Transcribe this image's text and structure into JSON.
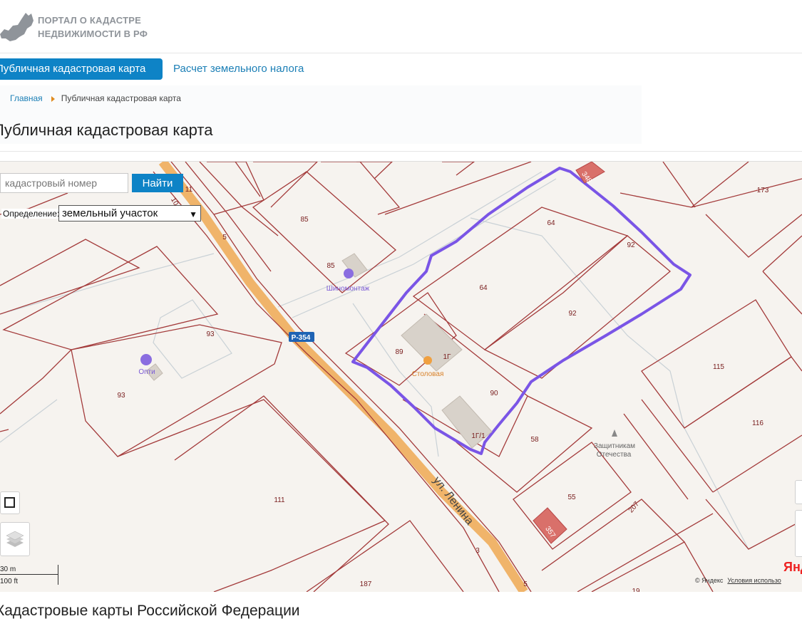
{
  "header": {
    "logo_line1": "ПОРТАЛ О КАДАСТРЕ",
    "logo_line2": "НЕДВИЖИМОСТИ В РФ",
    "logo_icon": "russia-map-icon"
  },
  "tabs": [
    {
      "label": "Публичная кадастровая карта",
      "active": true
    },
    {
      "label": "Расчет земельного налога",
      "active": false
    }
  ],
  "breadcrumb": {
    "home": "Главная",
    "current": "Публичная кадастровая карта"
  },
  "page_title": "Публичная кадастровая карта",
  "search": {
    "placeholder": "кадастровый номер",
    "button": "Найти"
  },
  "definition": {
    "label": "Определение:",
    "selected": "земельный участок"
  },
  "map": {
    "parcel_labels": [
      "64",
      "64",
      "92",
      "92",
      "85",
      "85",
      "93",
      "93",
      "89",
      "1Г",
      "90",
      "1Г/1",
      "58",
      "55",
      "115",
      "116",
      "173",
      "111",
      "187",
      "348",
      "357",
      "207",
      "3",
      "5",
      "5",
      "11",
      "10",
      "19"
    ],
    "poi": {
      "tire": "Шиномонтаж",
      "cafe": "Столовая",
      "fuel": "Опти",
      "monument_line1": "Защитникам",
      "monument_line2": "Отечества"
    },
    "road_badge": "Р-354",
    "street": "ул. Ленина",
    "scale_metric": "30 m",
    "scale_imperial": "100 ft",
    "copyright": "© Яндекс",
    "terms": "Условия использо",
    "yandex_logo": "Янд",
    "colors": {
      "parcel_border": "#a33a3a",
      "highlight": "#7a55e6",
      "road": "#f0b46a",
      "accent": "#0e83c6"
    }
  },
  "section_title": "Кадастровые карты Российской Федерации"
}
